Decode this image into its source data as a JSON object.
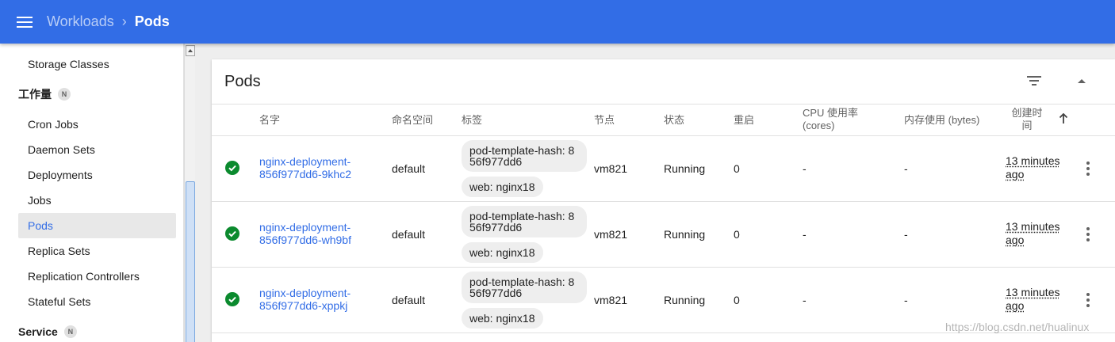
{
  "topbar": {
    "breadcrumb_parent": "Workloads",
    "breadcrumb_separator": "›",
    "breadcrumb_current": "Pods"
  },
  "sidebar": {
    "storage_classes": "Storage Classes",
    "workloads_section": "工作量",
    "workloads_badge": "N",
    "items": [
      "Cron Jobs",
      "Daemon Sets",
      "Deployments",
      "Jobs",
      "Pods",
      "Replica Sets",
      "Replication Controllers",
      "Stateful Sets"
    ],
    "active_item": "Pods",
    "service_section": "Service",
    "service_badge": "N"
  },
  "card": {
    "title": "Pods",
    "icons": {
      "filter": "filter-icon",
      "collapse": "chevron-up-icon",
      "sort": "arrow-up-icon",
      "status": "check-circle-icon",
      "more": "more-vert-icon"
    }
  },
  "table": {
    "headers": {
      "name": "名字",
      "namespace": "命名空间",
      "labels": "标签",
      "node": "节点",
      "status": "状态",
      "restarts": "重启",
      "cpu_line1": "CPU 使用率",
      "cpu_line2": "(cores)",
      "memory": "内存使用 (bytes)",
      "created_line1": "创建时",
      "created_line2": "间"
    },
    "rows": [
      {
        "name_line1": "nginx-deployment-",
        "name_line2": "856f977dd6-9khc2",
        "namespace": "default",
        "label_hash_line1": "pod-template-hash: 8",
        "label_hash_line2": "56f977dd6",
        "label_web": "web: nginx18",
        "node": "vm821",
        "status": "Running",
        "restarts": "0",
        "cpu": "-",
        "memory": "-",
        "age_line1": "13 minutes",
        "age_line2": "ago"
      },
      {
        "name_line1": "nginx-deployment-",
        "name_line2": "856f977dd6-wh9bf",
        "namespace": "default",
        "label_hash_line1": "pod-template-hash: 8",
        "label_hash_line2": "56f977dd6",
        "label_web": "web: nginx18",
        "node": "vm821",
        "status": "Running",
        "restarts": "0",
        "cpu": "-",
        "memory": "-",
        "age_line1": "13 minutes",
        "age_line2": "ago"
      },
      {
        "name_line1": "nginx-deployment-",
        "name_line2": "856f977dd6-xppkj",
        "namespace": "default",
        "label_hash_line1": "pod-template-hash: 8",
        "label_hash_line2": "56f977dd6",
        "label_web": "web: nginx18",
        "node": "vm821",
        "status": "Running",
        "restarts": "0",
        "cpu": "-",
        "memory": "-",
        "age_line1": "13 minutes",
        "age_line2": "ago"
      }
    ]
  },
  "watermark": "https://blog.csdn.net/hualinux",
  "colors": {
    "primary": "#326de6",
    "success": "#0b8a2e"
  }
}
